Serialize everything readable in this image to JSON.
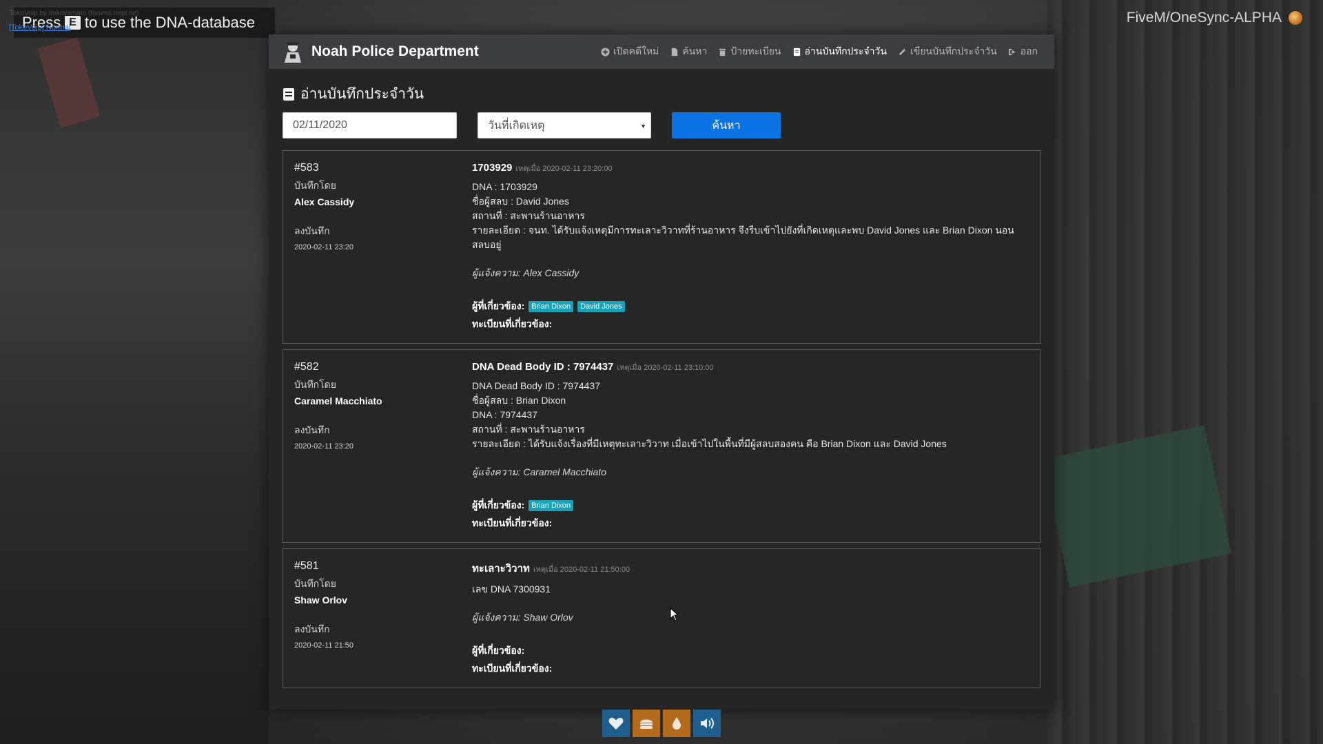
{
  "overlay": {
    "hint": {
      "prefix": "Press",
      "key": "E",
      "suffix": "to use the DNA-database"
    },
    "hint_faint": "TokoVoip by Itokoyamato (forums.mrpl.ne)",
    "hint_link": "[TokoVoip] Normal",
    "server_label": "FiveM/OneSync-ALPHA"
  },
  "app": {
    "title": "Noah Police Department",
    "nav": [
      {
        "label": "เปิดคดีใหม่",
        "icon": "plus-circle-icon"
      },
      {
        "label": "ค้นหา",
        "icon": "file-icon"
      },
      {
        "label": "ป้ายทะเบียน",
        "icon": "trash-icon"
      },
      {
        "label": "อ่านบันทึกประจำวัน",
        "icon": "book-icon",
        "active": true
      },
      {
        "label": "เขียนบันทึกประจำวัน",
        "icon": "pencil-icon"
      },
      {
        "label": "ออก",
        "icon": "sign-out-icon"
      }
    ]
  },
  "page": {
    "heading": "อ่านบันทึกประจำวัน",
    "filters": {
      "date_value": "02/11/2020",
      "select_value": "วันที่เกิดเหตุ",
      "search_button": "ค้นหา"
    },
    "meta_labels": {
      "recorded_by": "บันทึกโดย",
      "recorded_at": "ลงบันทึก"
    },
    "labels": {
      "occurred": "เหตุเมื่อ",
      "reporter": "ผู้แจ้งความ:",
      "involved": "ผู้ที่เกี่ยวข้อง:",
      "plates": "ทะเบียนที่เกี่ยวข้อง:"
    },
    "records": [
      {
        "id": "#583",
        "author": "Alex Cassidy",
        "recorded_at": "2020-02-11 23:20",
        "title": "1703929",
        "occurred_at": "2020-02-11 23:20:00",
        "lines": [
          "DNA : 1703929",
          "ชื่อผู้สลบ : David Jones",
          "สถานที่ : สะพานร้านอาหาร",
          "รายละเอียด : จนท. ได้รับแจ้งเหตุมีการทะเลาะวิวาทที่ร้านอาหาร จึงรีบเข้าไปยังที่เกิดเหตุและพบ David Jones และ Brian Dixon นอน สลบอยู่"
        ],
        "reporter": "Alex Cassidy",
        "involved": [
          "Brian Dixon",
          "David Jones"
        ]
      },
      {
        "id": "#582",
        "author": "Caramel Macchiato",
        "recorded_at": "2020-02-11 23:20",
        "title": "DNA Dead Body ID : 7974437",
        "occurred_at": "2020-02-11 23:10:00",
        "lines": [
          "DNA Dead Body ID : 7974437",
          "ชื่อผู้สลบ : Brian Dixon",
          "DNA : 7974437",
          "สถานที่ : สะพานร้านอาหาร",
          "รายละเอียด : ได้รับแจ้งเรื่องที่มีเหตุทะเลาะวิวาท เมื่อเข้าไปในพื้นที่มีผู้สลบสองคน คือ Brian Dixon และ David Jones"
        ],
        "reporter": "Caramel Macchiato",
        "involved": [
          "Brian Dixon"
        ]
      },
      {
        "id": "#581",
        "author": "Shaw Orlov",
        "recorded_at": "2020-02-11 21:50",
        "title": "ทะเลาะวิวาท",
        "occurred_at": "2020-02-11 21:50:00",
        "lines": [
          "เลข DNA 7300931"
        ],
        "reporter": "Shaw Orlov",
        "involved": []
      }
    ]
  },
  "hud": [
    {
      "name": "health",
      "icon": "heart-icon",
      "color": "#1f5f8e"
    },
    {
      "name": "food",
      "icon": "burger-icon",
      "color": "#b46a1c"
    },
    {
      "name": "water",
      "icon": "droplet-icon",
      "color": "#b46a1c"
    },
    {
      "name": "voice",
      "icon": "speaker-icon",
      "color": "#1f5f8e"
    }
  ]
}
